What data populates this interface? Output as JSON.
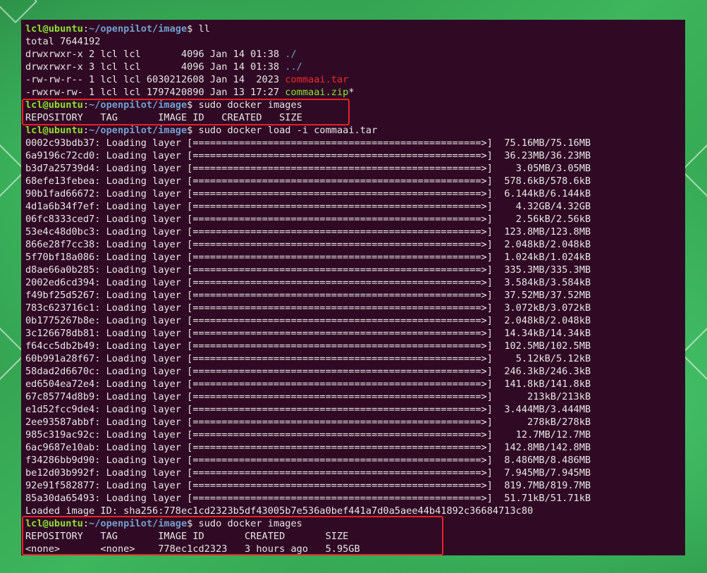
{
  "prompt": {
    "user": "lcl@ubuntu",
    "sep": ":",
    "path": "~/openpilot/image",
    "dollar": "$ "
  },
  "commands": {
    "ll": "ll",
    "images": "sudo docker images",
    "load": "sudo docker load -i commaai.tar"
  },
  "ls": {
    "total": "total 7644192",
    "entries": [
      {
        "meta": "drwxrwxr-x 2 lcl lcl       4096 Jan 14 01:38 ",
        "name": "./",
        "suffix": ""
      },
      {
        "meta": "drwxrwxr-x 3 lcl lcl       4096 Jan 14 01:38 ",
        "name": "../",
        "suffix": ""
      },
      {
        "meta": "-rw-rw-r-- 1 lcl lcl 6030212608 Jan 14  2023 ",
        "name": "commaai.tar",
        "suffix": ""
      },
      {
        "meta": "-rwxrw-rw- 1 lcl lcl 1797420890 Jan 13 17:27 ",
        "name": "commaai.zip",
        "suffix": "*"
      }
    ]
  },
  "images_empty": {
    "header": "REPOSITORY   TAG       IMAGE ID   CREATED   SIZE"
  },
  "layers": [
    {
      "id": "0002c93bdb37",
      "progress": "75.16MB/75.16MB"
    },
    {
      "id": "6a9196c72cd0",
      "progress": "36.23MB/36.23MB"
    },
    {
      "id": "b3d7a25739d4",
      "progress": "3.05MB/3.05MB"
    },
    {
      "id": "68efe13febea",
      "progress": "578.6kB/578.6kB"
    },
    {
      "id": "90b1fad66672",
      "progress": "6.144kB/6.144kB"
    },
    {
      "id": "4d1a6b34f7ef",
      "progress": "4.32GB/4.32GB"
    },
    {
      "id": "06fc8333ced7",
      "progress": "2.56kB/2.56kB"
    },
    {
      "id": "53e4c48d0bc3",
      "progress": "123.8MB/123.8MB"
    },
    {
      "id": "866e28f7cc38",
      "progress": "2.048kB/2.048kB"
    },
    {
      "id": "5f70bf18a086",
      "progress": "1.024kB/1.024kB"
    },
    {
      "id": "d8ae66a0b285",
      "progress": "335.3MB/335.3MB"
    },
    {
      "id": "2002ed6cd394",
      "progress": "3.584kB/3.584kB"
    },
    {
      "id": "f49bf25d5267",
      "progress": "37.52MB/37.52MB"
    },
    {
      "id": "783c623716c1",
      "progress": "3.072kB/3.072kB"
    },
    {
      "id": "0b1775267b8e",
      "progress": "2.048kB/2.048kB"
    },
    {
      "id": "3c126678db81",
      "progress": "14.34kB/14.34kB"
    },
    {
      "id": "f64cc5db2b49",
      "progress": "102.5MB/102.5MB"
    },
    {
      "id": "60b991a28f67",
      "progress": "5.12kB/5.12kB"
    },
    {
      "id": "58dad2d6670c",
      "progress": "246.3kB/246.3kB"
    },
    {
      "id": "ed6504ea72e4",
      "progress": "141.8kB/141.8kB"
    },
    {
      "id": "67c85774d8b9",
      "progress": "213kB/213kB"
    },
    {
      "id": "e1d52fcc9de4",
      "progress": "3.444MB/3.444MB"
    },
    {
      "id": "2ee93587abbf",
      "progress": "278kB/278kB"
    },
    {
      "id": "985c319ac92c",
      "progress": "12.7MB/12.7MB"
    },
    {
      "id": "6ac9687e10ab",
      "progress": "142.8MB/142.8MB"
    },
    {
      "id": "f34286bb9d90",
      "progress": "8.486MB/8.486MB"
    },
    {
      "id": "be12d03b992f",
      "progress": "7.945MB/7.945MB"
    },
    {
      "id": "92e91f582877",
      "progress": "819.7MB/819.7MB"
    },
    {
      "id": "85a30da65493",
      "progress": "51.71kB/51.71kB"
    }
  ],
  "layer_label": ": Loading layer ",
  "progress_bar": "[==================================================>]",
  "loaded_line": "Loaded image ID: sha256:778ec1cd2323b5df43005b7e536a0bef441a7d0a5aee44b41892c36684713c80",
  "images_final": {
    "header": "REPOSITORY   TAG       IMAGE ID       CREATED       SIZE",
    "row": "<none>       <none>    778ec1cd2323   3 hours ago   5.95GB"
  },
  "colors": {
    "terminal_bg": "#300a24",
    "prompt_user": "#8ae234",
    "prompt_path": "#729fcf",
    "tar_file": "#ef2929",
    "exec_file": "#8ae234",
    "highlight_box": "#e8202a"
  }
}
